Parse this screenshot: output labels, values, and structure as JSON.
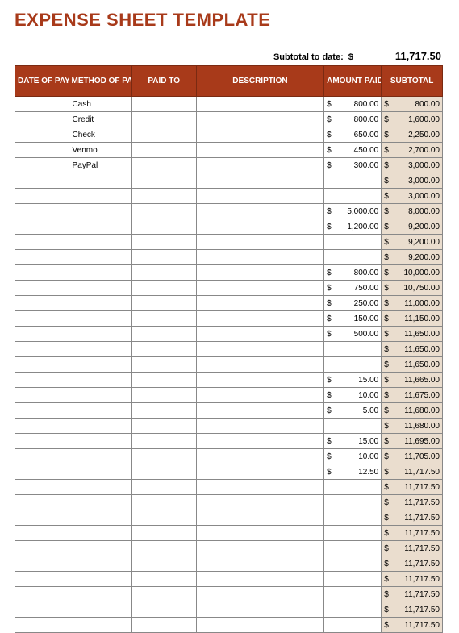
{
  "title": "EXPENSE SHEET TEMPLATE",
  "summary": {
    "label": "Subtotal to date:",
    "currency": "$",
    "value": "11,717.50"
  },
  "columns": {
    "date": "DATE OF PAYMENT",
    "method": "METHOD OF PAYMENT",
    "paid_to": "PAID TO",
    "description": "DESCRIPTION",
    "amount": "AMOUNT PAID",
    "subtotal": "SUBTOTAL"
  },
  "rows": [
    {
      "method": "Cash",
      "amount": "800.00",
      "subtotal": "800.00"
    },
    {
      "method": "Credit",
      "amount": "800.00",
      "subtotal": "1,600.00"
    },
    {
      "method": "Check",
      "amount": "650.00",
      "subtotal": "2,250.00"
    },
    {
      "method": "Venmo",
      "amount": "450.00",
      "subtotal": "2,700.00"
    },
    {
      "method": "PayPal",
      "amount": "300.00",
      "subtotal": "3,000.00"
    },
    {
      "method": "",
      "amount": "",
      "subtotal": "3,000.00"
    },
    {
      "method": "",
      "amount": "",
      "subtotal": "3,000.00"
    },
    {
      "method": "",
      "amount": "5,000.00",
      "subtotal": "8,000.00"
    },
    {
      "method": "",
      "amount": "1,200.00",
      "subtotal": "9,200.00"
    },
    {
      "method": "",
      "amount": "",
      "subtotal": "9,200.00"
    },
    {
      "method": "",
      "amount": "",
      "subtotal": "9,200.00"
    },
    {
      "method": "",
      "amount": "800.00",
      "subtotal": "10,000.00"
    },
    {
      "method": "",
      "amount": "750.00",
      "subtotal": "10,750.00"
    },
    {
      "method": "",
      "amount": "250.00",
      "subtotal": "11,000.00"
    },
    {
      "method": "",
      "amount": "150.00",
      "subtotal": "11,150.00"
    },
    {
      "method": "",
      "amount": "500.00",
      "subtotal": "11,650.00"
    },
    {
      "method": "",
      "amount": "",
      "subtotal": "11,650.00"
    },
    {
      "method": "",
      "amount": "",
      "subtotal": "11,650.00"
    },
    {
      "method": "",
      "amount": "15.00",
      "subtotal": "11,665.00"
    },
    {
      "method": "",
      "amount": "10.00",
      "subtotal": "11,675.00"
    },
    {
      "method": "",
      "amount": "5.00",
      "subtotal": "11,680.00"
    },
    {
      "method": "",
      "amount": "",
      "subtotal": "11,680.00"
    },
    {
      "method": "",
      "amount": "15.00",
      "subtotal": "11,695.00"
    },
    {
      "method": "",
      "amount": "10.00",
      "subtotal": "11,705.00"
    },
    {
      "method": "",
      "amount": "12.50",
      "subtotal": "11,717.50"
    },
    {
      "method": "",
      "amount": "",
      "subtotal": "11,717.50"
    },
    {
      "method": "",
      "amount": "",
      "subtotal": "11,717.50"
    },
    {
      "method": "",
      "amount": "",
      "subtotal": "11,717.50"
    },
    {
      "method": "",
      "amount": "",
      "subtotal": "11,717.50"
    },
    {
      "method": "",
      "amount": "",
      "subtotal": "11,717.50"
    },
    {
      "method": "",
      "amount": "",
      "subtotal": "11,717.50"
    },
    {
      "method": "",
      "amount": "",
      "subtotal": "11,717.50"
    },
    {
      "method": "",
      "amount": "",
      "subtotal": "11,717.50"
    },
    {
      "method": "",
      "amount": "",
      "subtotal": "11,717.50"
    },
    {
      "method": "",
      "amount": "",
      "subtotal": "11,717.50"
    }
  ],
  "chart_data": {
    "type": "table",
    "title": "Expense Sheet Template",
    "columns": [
      "DATE OF PAYMENT",
      "METHOD OF PAYMENT",
      "PAID TO",
      "DESCRIPTION",
      "AMOUNT PAID",
      "SUBTOTAL"
    ],
    "subtotal_to_date": 11717.5,
    "records": [
      {
        "method": "Cash",
        "amount_paid": 800.0,
        "subtotal": 800.0
      },
      {
        "method": "Credit",
        "amount_paid": 800.0,
        "subtotal": 1600.0
      },
      {
        "method": "Check",
        "amount_paid": 650.0,
        "subtotal": 2250.0
      },
      {
        "method": "Venmo",
        "amount_paid": 450.0,
        "subtotal": 2700.0
      },
      {
        "method": "PayPal",
        "amount_paid": 300.0,
        "subtotal": 3000.0
      },
      {
        "amount_paid": null,
        "subtotal": 3000.0
      },
      {
        "amount_paid": null,
        "subtotal": 3000.0
      },
      {
        "amount_paid": 5000.0,
        "subtotal": 8000.0
      },
      {
        "amount_paid": 1200.0,
        "subtotal": 9200.0
      },
      {
        "amount_paid": null,
        "subtotal": 9200.0
      },
      {
        "amount_paid": null,
        "subtotal": 9200.0
      },
      {
        "amount_paid": 800.0,
        "subtotal": 10000.0
      },
      {
        "amount_paid": 750.0,
        "subtotal": 10750.0
      },
      {
        "amount_paid": 250.0,
        "subtotal": 11000.0
      },
      {
        "amount_paid": 150.0,
        "subtotal": 11150.0
      },
      {
        "amount_paid": 500.0,
        "subtotal": 11650.0
      },
      {
        "amount_paid": null,
        "subtotal": 11650.0
      },
      {
        "amount_paid": null,
        "subtotal": 11650.0
      },
      {
        "amount_paid": 15.0,
        "subtotal": 11665.0
      },
      {
        "amount_paid": 10.0,
        "subtotal": 11675.0
      },
      {
        "amount_paid": 5.0,
        "subtotal": 11680.0
      },
      {
        "amount_paid": null,
        "subtotal": 11680.0
      },
      {
        "amount_paid": 15.0,
        "subtotal": 11695.0
      },
      {
        "amount_paid": 10.0,
        "subtotal": 11705.0
      },
      {
        "amount_paid": 12.5,
        "subtotal": 11717.5
      },
      {
        "amount_paid": null,
        "subtotal": 11717.5
      },
      {
        "amount_paid": null,
        "subtotal": 11717.5
      },
      {
        "amount_paid": null,
        "subtotal": 11717.5
      },
      {
        "amount_paid": null,
        "subtotal": 11717.5
      },
      {
        "amount_paid": null,
        "subtotal": 11717.5
      },
      {
        "amount_paid": null,
        "subtotal": 11717.5
      },
      {
        "amount_paid": null,
        "subtotal": 11717.5
      },
      {
        "amount_paid": null,
        "subtotal": 11717.5
      },
      {
        "amount_paid": null,
        "subtotal": 11717.5
      },
      {
        "amount_paid": null,
        "subtotal": 11717.5
      }
    ]
  }
}
